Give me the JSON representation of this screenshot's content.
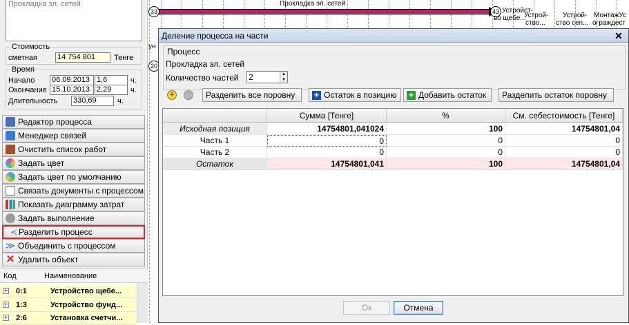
{
  "left": {
    "top_text": "Прокладка эл. сетей",
    "cost": {
      "group": "Стоимость",
      "label": "сметная",
      "value": "14 754 801",
      "unit": "Тенге"
    },
    "time": {
      "group": "Время",
      "start_label": "Начало",
      "start_date": "06.09.2013",
      "start_num": "1,6",
      "start_unit": "ч.",
      "end_label": "Окончание",
      "end_date": "15.10.2013",
      "end_num": "2,29",
      "end_unit": "ч.",
      "dur_label": "Длительность",
      "dur_value": "330,69",
      "dur_unit": "ч."
    },
    "commands": [
      {
        "label": "Редактор процесса",
        "icon": "process-editor-icon",
        "color": "#4b6fb5"
      },
      {
        "label": "Менеджер связей",
        "icon": "links-manager-icon",
        "color": "#3a7bd5"
      },
      {
        "label": "Очистить список работ",
        "icon": "broom-icon",
        "color": "#a0522d"
      },
      {
        "label": "Задать цвет",
        "icon": "palette-icon",
        "color": "#e04a9a"
      },
      {
        "label": "Задать цвет по умолчанию",
        "icon": "palette-default-icon",
        "color": "#4aa0e0"
      },
      {
        "label": "Связать документы с процессом",
        "icon": "document-link-icon",
        "color": "#7a7a7a"
      },
      {
        "label": "Показать диаграмму затрат",
        "icon": "bar-chart-icon",
        "color": "#c0392b"
      },
      {
        "label": "Задать выполнение",
        "icon": "progress-icon",
        "color": "#8a8a8a"
      },
      {
        "label": "Разделить процесс",
        "icon": "split-icon",
        "color": "#2f6fd0"
      },
      {
        "label": "Объединить с процессом",
        "icon": "merge-icon",
        "color": "#2f6fd0"
      },
      {
        "label": "Удалить объект",
        "icon": "delete-x-icon",
        "color": "#d0282d"
      }
    ],
    "tree": {
      "col_code": "Код",
      "col_name": "Наименование",
      "rows": [
        {
          "code": "0:1",
          "name": "Устройство щебе..."
        },
        {
          "code": "1:3",
          "name": "Устройство фунд..."
        },
        {
          "code": "2:6",
          "name": "Установка счетчи..."
        }
      ]
    }
  },
  "gantt": {
    "bar_label": "Прокладка эл. сетей",
    "node_left": "33",
    "node_right": "43",
    "node_lower": "20",
    "left_edge_text": "ун",
    "right_labels": [
      {
        "l1": "Устройст-",
        "l2": "во щебе..."
      },
      {
        "l1": "Устрой-",
        "l2": "ство..."
      },
      {
        "l1": "Устрой-",
        "l2": "ство сеп..."
      },
      {
        "l1": "МонтажУс",
        "l2": "ограждест"
      }
    ]
  },
  "dialog": {
    "title": "Деление процесса на части",
    "process_label": "Процесс",
    "process_name": "Прокладка эл. сетей",
    "parts_label": "Количество частей",
    "parts_value": "2",
    "buttons": {
      "split_all": "Разделить все поровну",
      "remainder_pos": "Остаток в позицию",
      "add_remainder": "Добавить остаток",
      "split_remainder": "Разделить остаток поровну",
      "ok": "Ок",
      "cancel": "Отмена"
    },
    "table": {
      "headers": [
        "",
        "Сумма [Тенге]",
        "%",
        "См. себестоимость [Тенге]"
      ],
      "rows": [
        {
          "name": "Исходная позиция",
          "sum": "14754801,041024",
          "pct": "100",
          "cost": "14754801,04"
        },
        {
          "name": "Часть 1",
          "sum": "0",
          "pct": "0",
          "cost": "0"
        },
        {
          "name": "Часть 2",
          "sum": "0",
          "pct": "0",
          "cost": "0"
        },
        {
          "name": "Остаток",
          "sum": "14754801,041",
          "pct": "100",
          "cost": "14754801,04"
        }
      ]
    }
  }
}
